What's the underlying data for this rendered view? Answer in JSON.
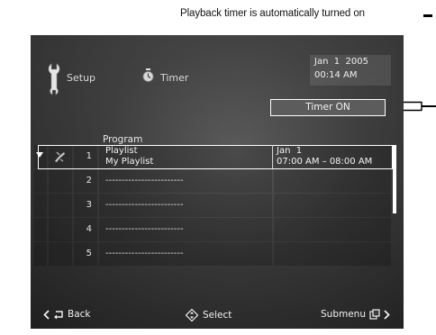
{
  "annotation": {
    "text": "Playback timer is automatically turned on"
  },
  "header": {
    "setup_label": "Setup",
    "timer_label": "Timer",
    "date": "Jan  1  2005",
    "time": "00:14 AM"
  },
  "timer_status": "Timer ON",
  "table": {
    "column_header": "Program",
    "rows": [
      {
        "num": "1",
        "title": "Playlist",
        "subtitle": "My Playlist",
        "date": "Jan  1",
        "time": "07:00 AM – 08:00 AM"
      },
      {
        "num": "2",
        "placeholder": "------------------------"
      },
      {
        "num": "3",
        "placeholder": "------------------------"
      },
      {
        "num": "4",
        "placeholder": "------------------------"
      },
      {
        "num": "5",
        "placeholder": "------------------------"
      }
    ]
  },
  "footer": {
    "back": "Back",
    "select": "Select",
    "submenu": "Submenu"
  },
  "icons": {
    "setup": "wrench-icon",
    "timer": "timer-icon",
    "row1": "playlist-icon",
    "back": "return-arrow-icon",
    "select": "select-dial-icon",
    "submenu": "submenu-icon"
  },
  "colors": {
    "accent": "#ffffff",
    "background": "#3c3c3c"
  }
}
